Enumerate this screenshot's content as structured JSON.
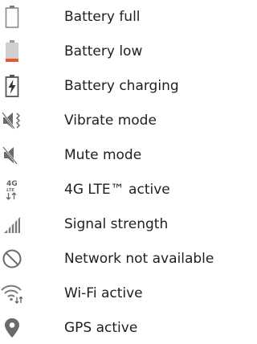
{
  "items": [
    {
      "label": "Battery full",
      "icon": "battery-full-icon"
    },
    {
      "label": "Battery low",
      "icon": "battery-low-icon"
    },
    {
      "label": "Battery charging",
      "icon": "battery-charging-icon"
    },
    {
      "label": "Vibrate mode",
      "icon": "vibrate-mode-icon"
    },
    {
      "label": "Mute mode",
      "icon": "mute-mode-icon"
    },
    {
      "label": "4G LTE™ active",
      "icon": "4g-lte-icon",
      "icon_text_top": "4G",
      "icon_text_mid": "LTE"
    },
    {
      "label": "Signal strength",
      "icon": "signal-strength-icon"
    },
    {
      "label": "Network not available",
      "icon": "network-unavailable-icon"
    },
    {
      "label": "Wi-Fi active",
      "icon": "wifi-active-icon"
    },
    {
      "label": "GPS active",
      "icon": "gps-active-icon"
    }
  ],
  "colors": {
    "icon": "#5f5f5f",
    "battery_low": "#e8582e"
  }
}
